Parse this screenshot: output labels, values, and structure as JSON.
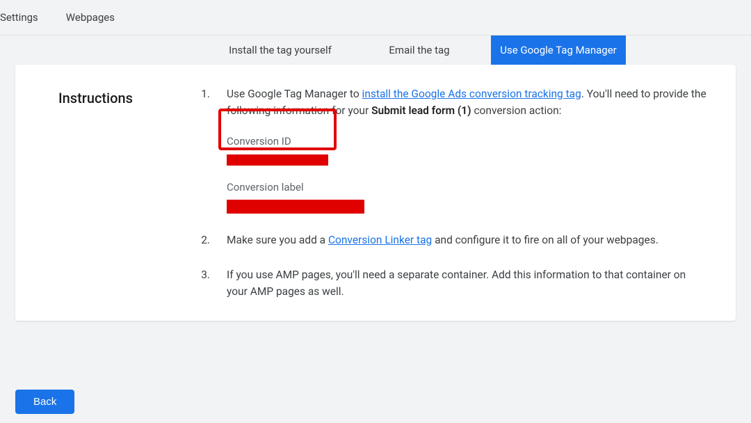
{
  "nav": {
    "settings": "Settings",
    "webpages": "Webpages"
  },
  "tabs": {
    "install_yourself": "Install the tag yourself",
    "email_tag": "Email the tag",
    "use_gtm": "Use Google Tag Manager"
  },
  "instructions": {
    "heading": "Instructions",
    "step1": {
      "num": "1.",
      "pre": "Use Google Tag Manager to ",
      "link": "install the Google Ads conversion tracking tag",
      "post1": ". You'll need to provide the following information for your ",
      "action_name": "Submit lead form (1)",
      "post2": " conversion action:",
      "conversion_id_label": "Conversion ID",
      "conversion_label_label": "Conversion label"
    },
    "step2": {
      "num": "2.",
      "pre": "Make sure you add a ",
      "link": "Conversion Linker tag",
      "post": " and configure it to fire on all of your webpages."
    },
    "step3": {
      "num": "3.",
      "text": "If you use AMP pages, you'll need a separate container. Add this information to that container on your AMP pages as well."
    }
  },
  "buttons": {
    "back": "Back"
  }
}
